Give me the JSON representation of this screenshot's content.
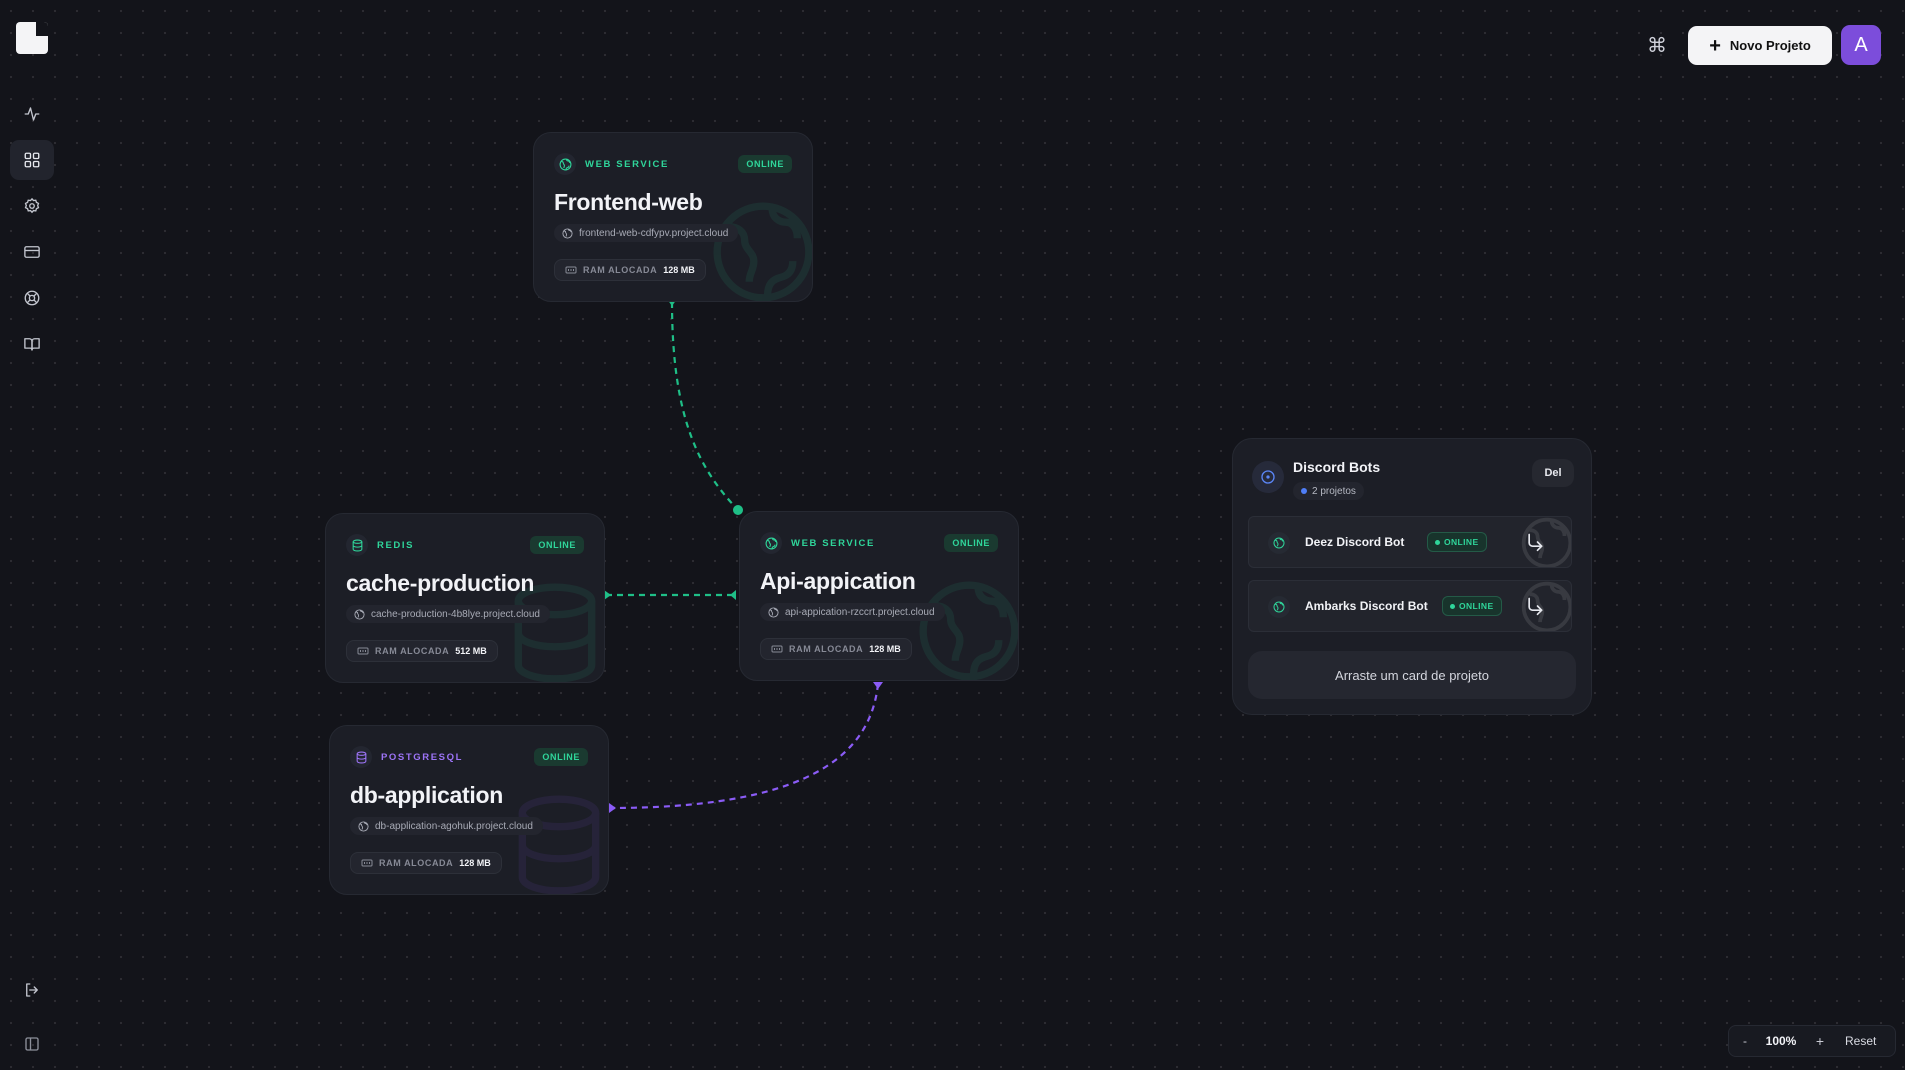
{
  "topbar": {
    "command_icon": "command-icon",
    "new_project_label": "Novo Projeto",
    "avatar_initial": "A"
  },
  "sidebar": {
    "items": [
      {
        "icon": "activity-icon",
        "active": false
      },
      {
        "icon": "dashboard-grid-icon",
        "active": true
      },
      {
        "icon": "gear-icon",
        "active": false
      },
      {
        "icon": "credit-card-icon",
        "active": false
      },
      {
        "icon": "support-lifebuoy-icon",
        "active": false
      },
      {
        "icon": "book-icon",
        "active": false
      }
    ],
    "bottom": [
      {
        "icon": "logout-icon"
      },
      {
        "icon": "sidebar-toggle-icon"
      }
    ]
  },
  "cards": {
    "frontend": {
      "type": "WEB SERVICE",
      "status": "ONLINE",
      "name": "Frontend-web",
      "url": "frontend-web-cdfypv.project.cloud",
      "ram_label": "RAM ALOCADA",
      "ram_value": "128 MB"
    },
    "cache": {
      "type": "REDIS",
      "status": "ONLINE",
      "name": "cache-production",
      "url": "cache-production-4b8lye.project.cloud",
      "ram_label": "RAM ALOCADA",
      "ram_value": "512 MB"
    },
    "api": {
      "type": "WEB SERVICE",
      "status": "ONLINE",
      "name": "Api-appication",
      "url": "api-appication-rzccrt.project.cloud",
      "ram_label": "RAM ALOCADA",
      "ram_value": "128 MB"
    },
    "db": {
      "type": "POSTGRESQL",
      "status": "ONLINE",
      "name": "db-application",
      "url": "db-application-agohuk.project.cloud",
      "ram_label": "RAM ALOCADA",
      "ram_value": "128 MB"
    }
  },
  "group": {
    "title": "Discord Bots",
    "count": "2 projetos",
    "delete_label": "Del",
    "items": [
      {
        "name": "Deez Discord Bot",
        "status": "ONLINE"
      },
      {
        "name": "Ambarks Discord Bot",
        "status": "ONLINE"
      }
    ],
    "drop_hint": "Arraste um card de projeto"
  },
  "zoom": {
    "minus": "-",
    "value": "100%",
    "plus": "+",
    "reset": "Reset"
  },
  "colors": {
    "accent_green": "#2fd59a",
    "accent_purple": "#8b5cf6",
    "background": "#13141a",
    "card": "#1c1e26"
  }
}
